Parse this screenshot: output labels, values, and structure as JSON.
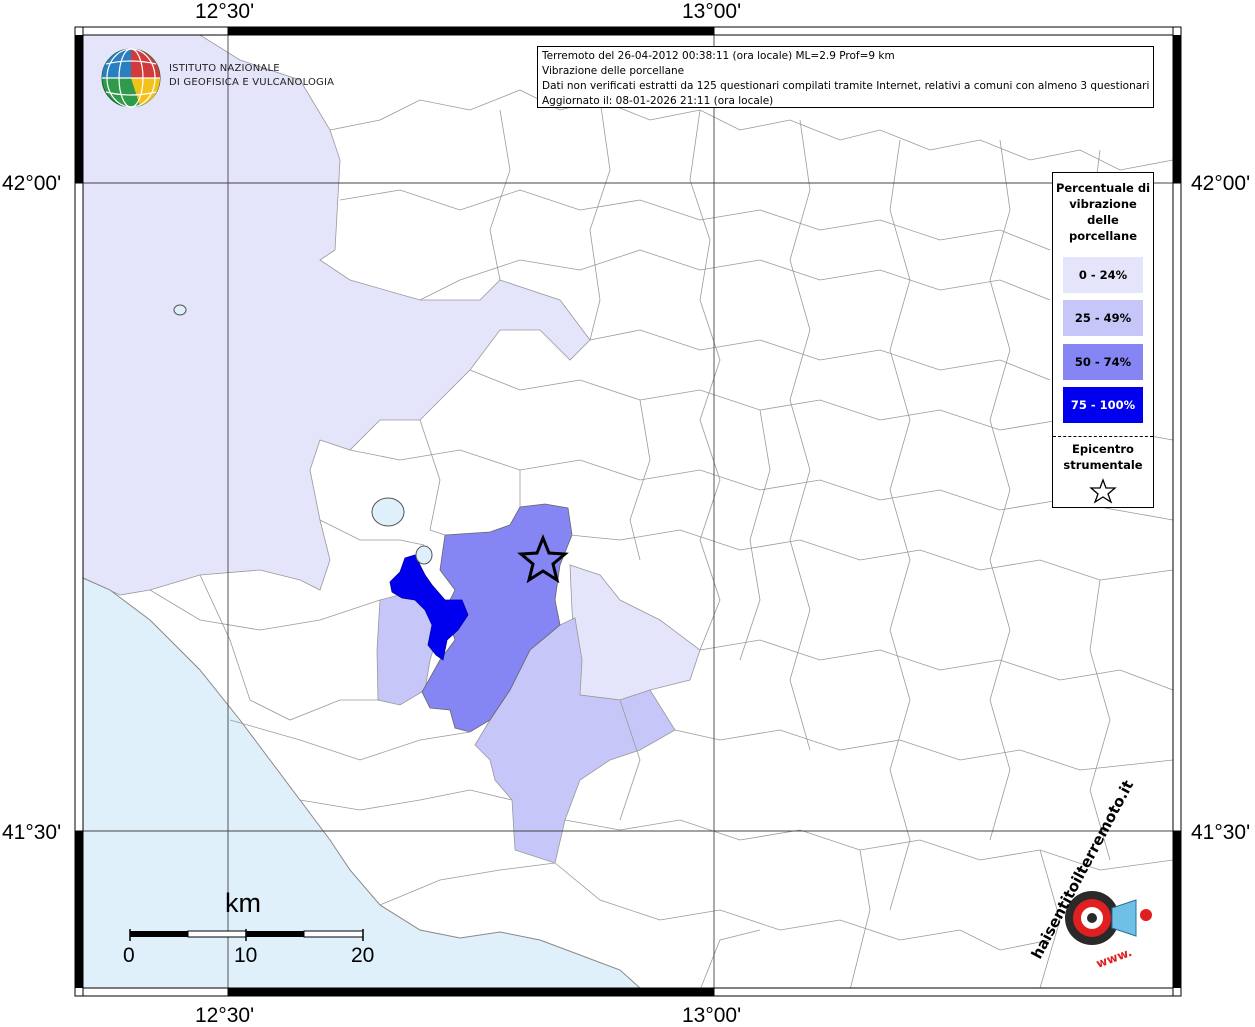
{
  "header": {
    "line1": "Terremoto del 26-04-2012 00:38:11 (ora locale) ML=2.9 Prof=9 km",
    "line2": "Vibrazione delle porcellane",
    "line3": "Dati non verificati estratti da 125 questionari compilati tramite Internet, relativi a comuni con almeno 3 questionari.",
    "line4": "Aggiornato il: 08-01-2026 21:11 (ora locale)"
  },
  "coords": {
    "top_left": "12°30'",
    "top_right": "13°00'",
    "bottom_left": "12°30'",
    "bottom_right": "13°00'",
    "left_upper": "42°00'",
    "left_lower": "41°30'",
    "right_upper": "42°00'",
    "right_lower": "41°30'"
  },
  "legend": {
    "title": "Percentuale di vibrazione delle porcellane",
    "items": [
      {
        "label": "0 - 24%",
        "color": "#e4e4fb",
        "text_color": "#000000"
      },
      {
        "label": "25 - 49%",
        "color": "#c6c6f8",
        "text_color": "#000000"
      },
      {
        "label": "50 - 74%",
        "color": "#8585f3",
        "text_color": "#000000"
      },
      {
        "label": "75 - 100%",
        "color": "#0000ee",
        "text_color": "#ffffff"
      }
    ],
    "epicenter_label": "Epicentro strumentale"
  },
  "logo": {
    "institute_line1": "ISTITUTO NAZIONALE",
    "institute_line2": "DI GEOFISICA E VULCANOLOGIA",
    "haisentito_text": "haisentitoilterremoto.it",
    "www_text": "www."
  },
  "scale": {
    "unit": "km",
    "ticks": [
      "0",
      "10",
      "20"
    ]
  },
  "colors": {
    "sea": "#dff0fb",
    "land": "#ffffff",
    "border": "#999999",
    "frame": "#000000"
  }
}
